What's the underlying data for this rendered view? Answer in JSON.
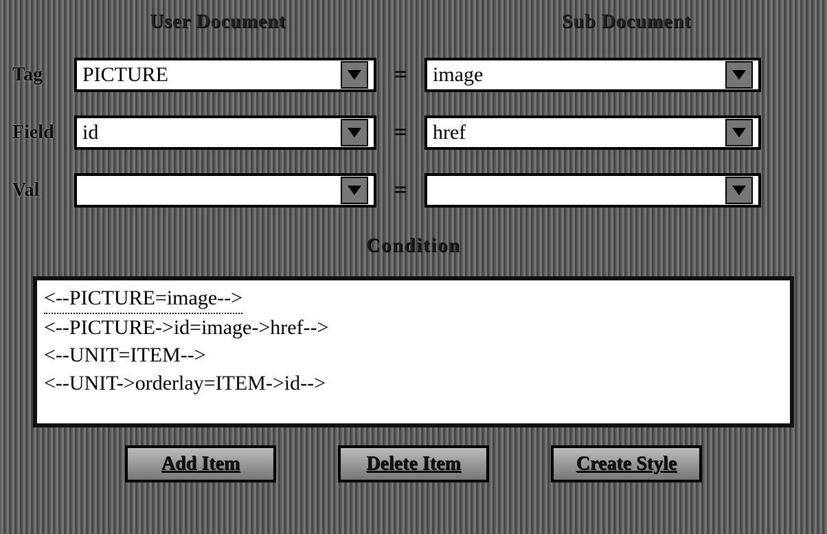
{
  "headers": {
    "left": "User Document",
    "right": "Sub Document"
  },
  "labels": {
    "tag": "Tag",
    "field": "Field",
    "val": "Val",
    "equals": "=",
    "condition": "Condition"
  },
  "inputs": {
    "tag_left": "PICTURE",
    "tag_right": "image",
    "field_left": "id",
    "field_right": "href",
    "val_left": "",
    "val_right": ""
  },
  "list": {
    "items": [
      "<--PICTURE=image-->",
      "<--PICTURE->id=image->href-->",
      "<--UNIT=ITEM-->",
      "<--UNIT->orderlay=ITEM->id-->"
    ],
    "selected_index": 0
  },
  "buttons": {
    "add": "Add Item",
    "delete": "Delete Item",
    "create": "Create Style"
  }
}
